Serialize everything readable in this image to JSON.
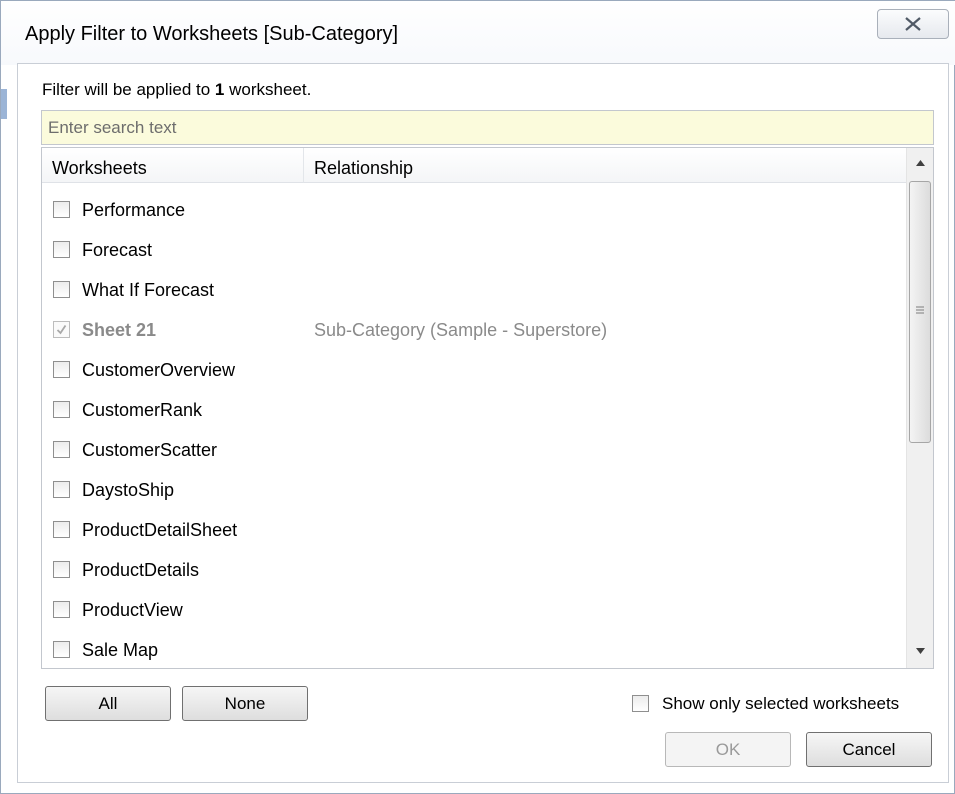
{
  "window": {
    "title": "Apply Filter to Worksheets [Sub-Category]"
  },
  "info": {
    "prefix": "Filter will be applied to ",
    "count": "1",
    "suffix": " worksheet."
  },
  "search": {
    "placeholder": "Enter search text",
    "value": ""
  },
  "table": {
    "headers": [
      "Worksheets",
      "Relationship"
    ],
    "rows": [
      {
        "name": "Performance",
        "relationship": "",
        "checked": false,
        "disabled": false
      },
      {
        "name": "Forecast",
        "relationship": "",
        "checked": false,
        "disabled": false
      },
      {
        "name": "What If Forecast",
        "relationship": "",
        "checked": false,
        "disabled": false
      },
      {
        "name": "Sheet 21",
        "relationship": "Sub-Category (Sample - Superstore)",
        "checked": true,
        "disabled": true
      },
      {
        "name": "CustomerOverview",
        "relationship": "",
        "checked": false,
        "disabled": false
      },
      {
        "name": "CustomerRank",
        "relationship": "",
        "checked": false,
        "disabled": false
      },
      {
        "name": "CustomerScatter",
        "relationship": "",
        "checked": false,
        "disabled": false
      },
      {
        "name": "DaystoShip",
        "relationship": "",
        "checked": false,
        "disabled": false
      },
      {
        "name": "ProductDetailSheet",
        "relationship": "",
        "checked": false,
        "disabled": false
      },
      {
        "name": "ProductDetails",
        "relationship": "",
        "checked": false,
        "disabled": false
      },
      {
        "name": "ProductView",
        "relationship": "",
        "checked": false,
        "disabled": false
      },
      {
        "name": "Sale Map",
        "relationship": "",
        "checked": false,
        "disabled": false
      }
    ]
  },
  "buttons": {
    "all": "All",
    "none": "None",
    "ok": "OK",
    "cancel": "Cancel"
  },
  "show_only": {
    "label": "Show only selected worksheets",
    "checked": false
  },
  "icons": {
    "close": "close-icon",
    "scroll_up": "arrow-up-icon",
    "scroll_down": "arrow-down-icon",
    "check": "checkmark-icon"
  }
}
